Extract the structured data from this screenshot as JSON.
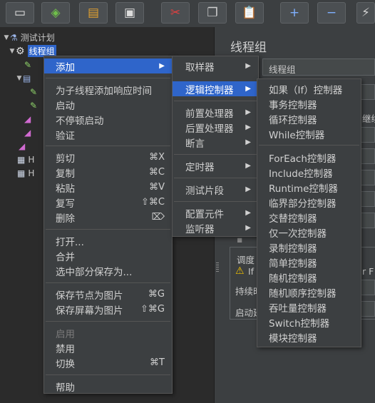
{
  "toolbar": {
    "buttons": [
      {
        "name": "new-button",
        "icon": "new-file-icon",
        "glyph": "▭",
        "color": "#e8e8e8"
      },
      {
        "name": "templates-button",
        "icon": "templates-icon",
        "glyph": "◈",
        "color": "#6fbf4a"
      },
      {
        "name": "open-button",
        "icon": "folder-open-icon",
        "glyph": "▤",
        "color": "#e0a030"
      },
      {
        "name": "save-button",
        "icon": "save-icon",
        "glyph": "▣",
        "color": "#dcdcdc"
      },
      {
        "name": "cut-button",
        "icon": "scissors-icon",
        "glyph": "✂",
        "color": "#e04040"
      },
      {
        "name": "copy-button",
        "icon": "copy-icon",
        "glyph": "❐",
        "color": "#d0d0d0"
      },
      {
        "name": "paste-button",
        "icon": "paste-icon",
        "glyph": "📋",
        "color": "#e0a030"
      },
      {
        "name": "expand-button",
        "icon": "plus-icon",
        "glyph": "+",
        "color": "#7fb0ff"
      },
      {
        "name": "collapse-button",
        "icon": "minus-icon",
        "glyph": "−",
        "color": "#7fb0ff"
      },
      {
        "name": "toggle-button",
        "icon": "wand-icon",
        "glyph": "⚡",
        "color": "#d0d0d0"
      }
    ]
  },
  "tree": {
    "root": "测试计划",
    "thread_group": "线程组",
    "items_partial": [
      "H",
      "H"
    ]
  },
  "context_menu": {
    "add": "添加",
    "add_think_time": "为子线程添加响应时间",
    "start": "启动",
    "start_no_pause": "不停顿启动",
    "validate": "验证",
    "cut": "剪切",
    "cut_sc": "⌘X",
    "copy": "复制",
    "copy_sc": "⌘C",
    "paste": "粘贴",
    "paste_sc": "⌘V",
    "duplicate": "复写",
    "duplicate_sc": "⇧⌘C",
    "delete": "删除",
    "delete_sc": "⌦",
    "open": "打开...",
    "merge": "合并",
    "save_selection": "选中部分保存为...",
    "save_node_image": "保存节点为图片",
    "save_node_image_sc": "⌘G",
    "save_screen_image": "保存屏幕为图片",
    "save_screen_image_sc": "⇧⌘G",
    "enable": "启用",
    "disable": "禁用",
    "toggle": "切换",
    "toggle_sc": "⌘T",
    "help": "帮助"
  },
  "add_submenu": {
    "sampler": "取样器",
    "logic_controller": "逻辑控制器",
    "pre_processor": "前置处理器",
    "post_processor": "后置处理器",
    "assertion": "断言",
    "timer": "定时器",
    "test_fragment": "测试片段",
    "config_element": "配置元件",
    "listener": "监听器"
  },
  "logic_submenu": {
    "items": [
      "如果（If）控制器",
      "事务控制器",
      "循环控制器",
      "While控制器",
      "ForEach控制器",
      "Include控制器",
      "Runtime控制器",
      "临界部分控制器",
      "交替控制器",
      "仅一次控制器",
      "录制控制器",
      "简单控制器",
      "随机控制器",
      "随机顺序控制器",
      "吞吐量控制器",
      "Switch控制器",
      "模块控制器"
    ]
  },
  "right_panel": {
    "title": "线程组",
    "name_value": "线程组",
    "partial_continue": "继续",
    "partial_schedule": "调度",
    "partial_if": "If",
    "partial_for": "r F",
    "partial_duration": "持续时",
    "partial_start": "启动延"
  }
}
